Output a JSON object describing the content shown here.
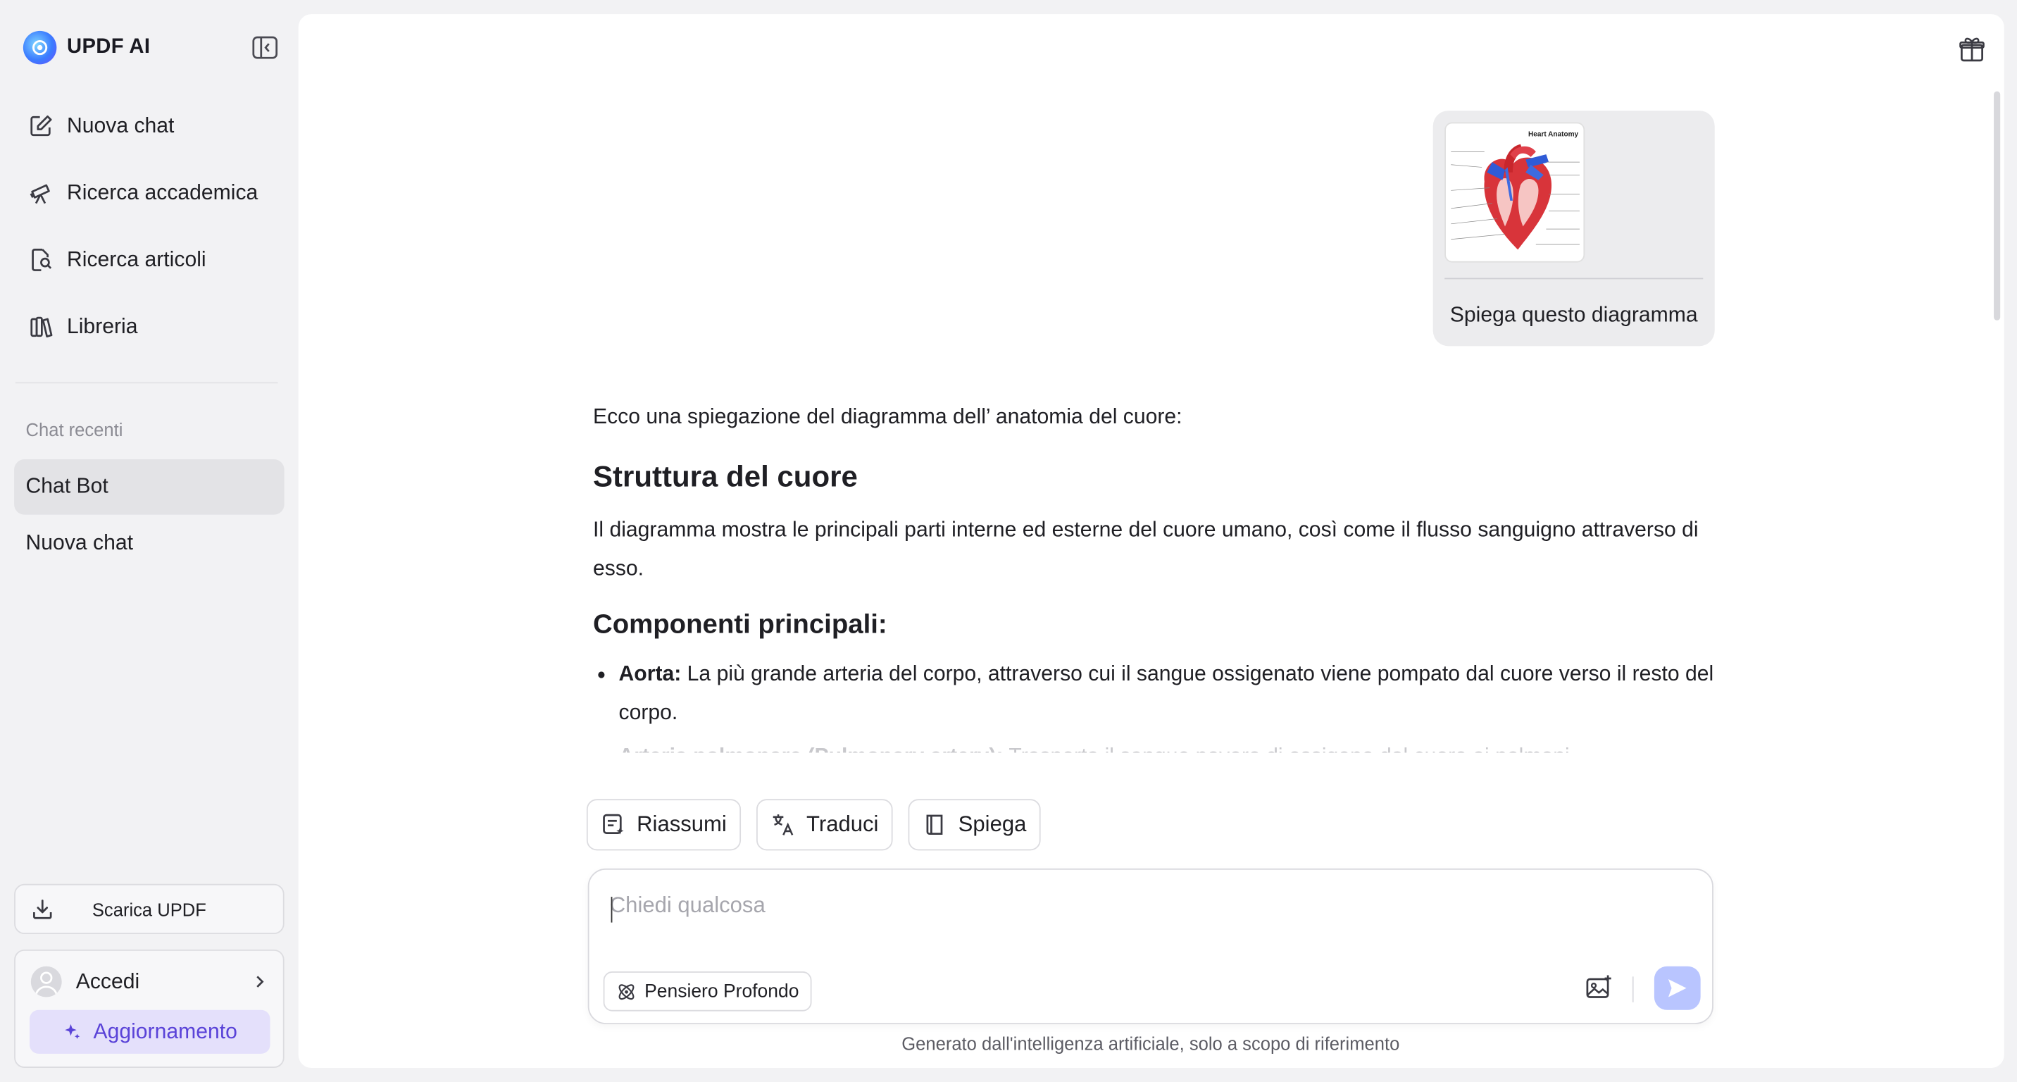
{
  "app": {
    "name": "UPDF AI"
  },
  "sidebar": {
    "nav": [
      {
        "label": "Nuova chat",
        "icon": "edit-icon"
      },
      {
        "label": "Ricerca accademica",
        "icon": "telescope-icon"
      },
      {
        "label": "Ricerca articoli",
        "icon": "document-search-icon"
      },
      {
        "label": "Libreria",
        "icon": "library-icon"
      }
    ],
    "recent_title": "Chat recenti",
    "recent": [
      {
        "label": "Chat Bot",
        "active": true
      },
      {
        "label": "Nuova chat",
        "active": false
      }
    ],
    "download_label": "Scarica UPDF",
    "account_label": "Accedi",
    "upgrade_label": "Aggiornamento"
  },
  "conversation": {
    "user_message": {
      "image_title": "Heart Anatomy",
      "text": "Spiega questo diagramma"
    },
    "answer": {
      "intro": "Ecco una spiegazione del diagramma dell’  anatomia del cuore:",
      "heading1": "Struttura del cuore",
      "paragraph1": "Il diagramma mostra le principali parti interne ed esterne del cuore umano, così come il flusso sanguigno attraverso di esso.",
      "heading2": "Componenti principali:",
      "items": [
        {
          "term": "Aorta:",
          "text": " La più grande arteria del corpo, attraverso cui il sangue ossigenato viene pompato dal cuore verso il resto del corpo."
        },
        {
          "term": "Arteria polmonare (Pulmonary artery):",
          "text": " Trasporta il sangue povero di ossigeno dal cuore ai polmoni."
        }
      ]
    }
  },
  "actions": [
    {
      "label": "Riassumi",
      "icon": "summary-icon"
    },
    {
      "label": "Traduci",
      "icon": "translate-icon"
    },
    {
      "label": "Spiega",
      "icon": "book-icon"
    }
  ],
  "composer": {
    "placeholder": "Chiedi qualcosa",
    "value": "",
    "deep_thinking_label": "Pensiero Profondo"
  },
  "footnote": "Generato dall'intelligenza artificiale, solo a scopo di riferimento",
  "colors": {
    "accent": "#5a43d8",
    "upgrade_bg": "#e4e0fb",
    "send_bg": "#b9c5ff",
    "active_recent": "#e3e3e6"
  }
}
